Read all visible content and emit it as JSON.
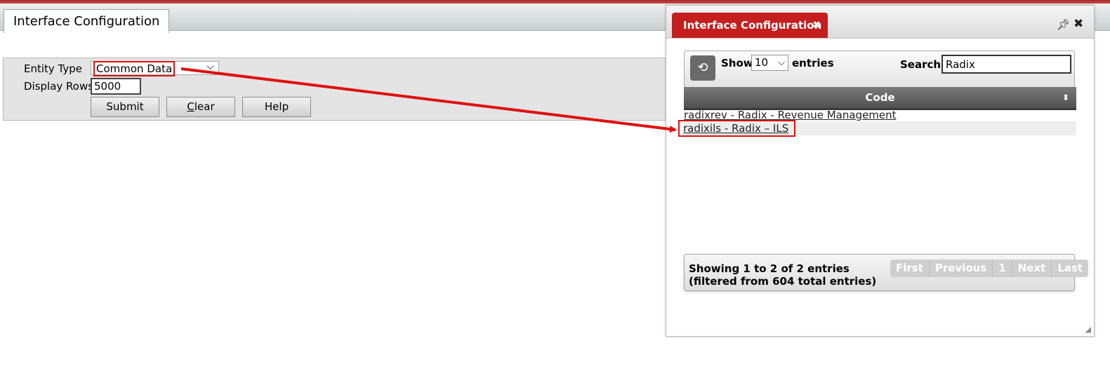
{
  "page": {
    "tab_title": "Interface Configuration"
  },
  "form": {
    "entity_type_label": "Entity Type",
    "entity_type_value": "Common Data",
    "display_rows_label": "Display Rows",
    "display_rows_value": "5000",
    "submit_label": "Submit",
    "clear_label_underlined": "C",
    "clear_label_rest": "lear",
    "help_label": "Help"
  },
  "dialog": {
    "title": "Interface Configuration",
    "tab_close_icon": "✖",
    "pin_icon": "pin-icon",
    "close_icon": "✖",
    "show_label": "Show",
    "page_length": "10",
    "entries_label": "entries",
    "search_label": "Search:",
    "search_value": "Radix",
    "column_header": "Code",
    "rows": [
      {
        "text": "radixrev - Radix - Revenue Management"
      },
      {
        "text": "radixils - Radix – ILS"
      }
    ],
    "info": "Showing 1 to 2 of 2 entries (filtered from 604 total entries)",
    "pager": [
      "First",
      "Previous",
      "1",
      "Next",
      "Last"
    ]
  },
  "colors": {
    "accent_red": "#c41e1e",
    "highlight_red": "#e01010"
  }
}
